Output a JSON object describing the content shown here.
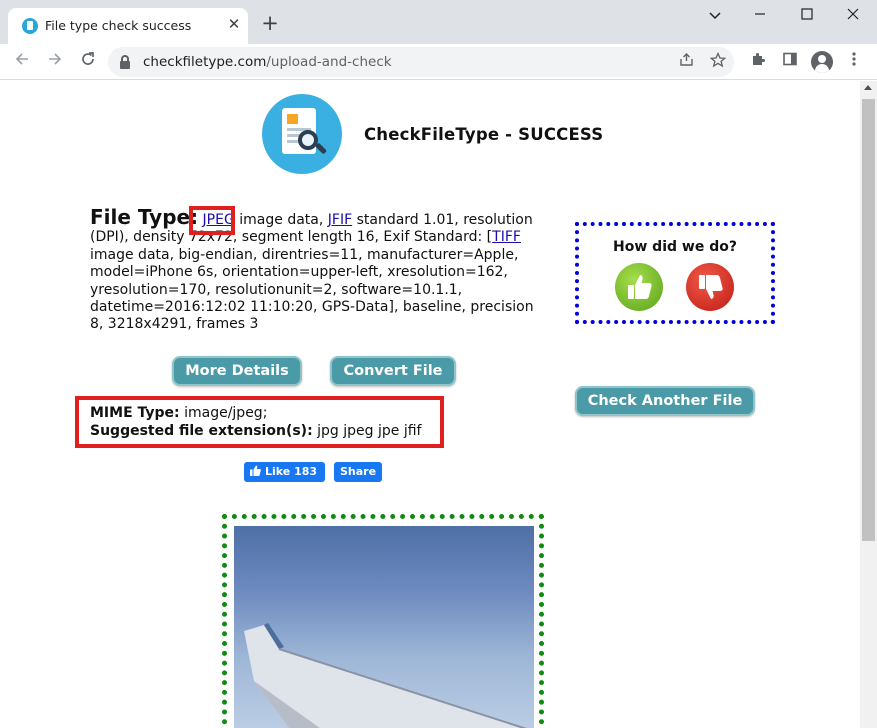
{
  "browser": {
    "tab_title": "File type check success",
    "tab_close": "✕",
    "new_tab": "+",
    "url_domain": "checkfiletype.com",
    "url_path": "/upload-and-check"
  },
  "page": {
    "heading": "CheckFileType - SUCCESS",
    "file_type_label": "File Type:",
    "jpeg_link": "JPEG",
    "desc_part1": " image data, ",
    "jfif_link": "JFIF",
    "desc_part2": " standard 1.01, resolution (DPI), density 72x72, segment length 16, Exif Standard: [",
    "tiff_link": "TIFF",
    "desc_part3": " image data, big-endian, direntries=11, manufacturer=Apple, model=iPhone 6s, orientation=upper-left, xresolution=162, yresolution=170, resolutionunit=2, software=10.1.1, datetime=2016:12:02 11:10:20, GPS-Data], baseline, precision 8, 3218x4291, frames 3",
    "more_details_button": "More Details",
    "convert_file_button": "Convert File",
    "check_another_button": "Check Another File",
    "mime_label": "MIME Type:",
    "mime_value": " image/jpeg;",
    "ext_label": "Suggested file extension(s):",
    "ext_value": " jpg jpeg jpe jfif",
    "fb_like": "Like 183",
    "fb_share": "Share",
    "feedback_title": "How did we do?"
  },
  "colors": {
    "accent_teal": "#4a9aa8",
    "highlight_red": "#e0201f",
    "feedback_border": "#0000e0",
    "preview_border": "#108a10",
    "facebook_blue": "#1877f2"
  }
}
